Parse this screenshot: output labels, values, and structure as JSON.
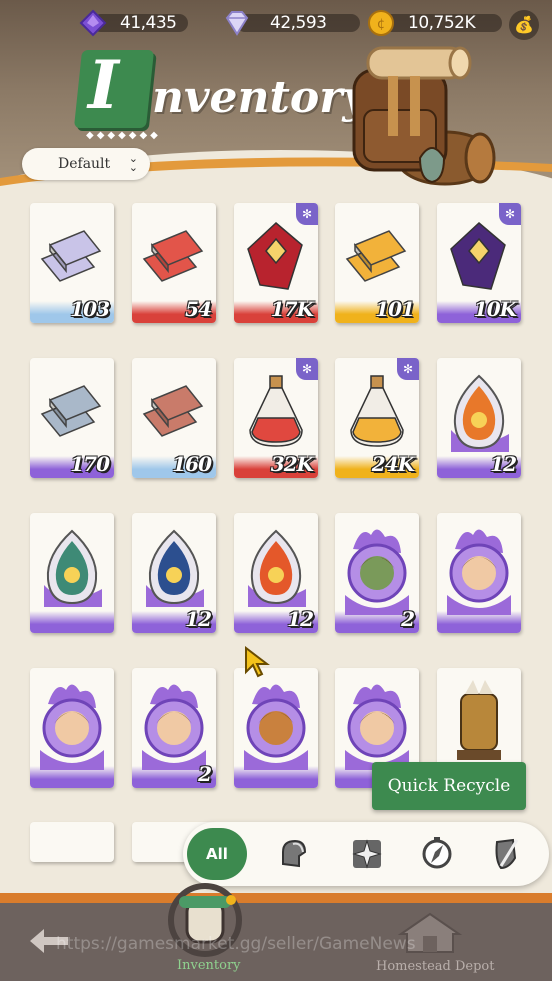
{
  "resources": [
    {
      "name": "amethyst-icon",
      "value": "41,435",
      "color": "#7b4fd4"
    },
    {
      "name": "diamond-icon",
      "value": "42,593",
      "color": "#c9c2ee"
    },
    {
      "name": "gold-coin-icon",
      "value": "10,752K",
      "color": "#f0b21c"
    }
  ],
  "header": {
    "title_initial": "I",
    "title_rest": "nventory"
  },
  "sort": {
    "label": "Default"
  },
  "items": [
    {
      "icon": "silver-ingot-icon",
      "qty": "103",
      "rarity": "#9fc7ea",
      "badge": false
    },
    {
      "icon": "red-ingot-icon",
      "qty": "54",
      "rarity": "#d9413a",
      "badge": false
    },
    {
      "icon": "ruby-gem-icon",
      "qty": "17K",
      "rarity": "#d9413a",
      "badge": true
    },
    {
      "icon": "gold-ingot-icon",
      "qty": "101",
      "rarity": "#f0b21c",
      "badge": false
    },
    {
      "icon": "purple-gem-icon",
      "qty": "10K",
      "rarity": "#8e62d9",
      "badge": true
    },
    {
      "icon": "steel-ingot-icon",
      "qty": "170",
      "rarity": "#8e62d9",
      "badge": false
    },
    {
      "icon": "copper-ingot-icon",
      "qty": "160",
      "rarity": "#9fc7ea",
      "badge": false
    },
    {
      "icon": "red-potion-icon",
      "qty": "32K",
      "rarity": "#d9413a",
      "badge": true
    },
    {
      "icon": "gold-potion-icon",
      "qty": "24K",
      "rarity": "#f0b21c",
      "badge": true
    },
    {
      "icon": "fire-egg-icon",
      "qty": "12",
      "rarity": "#8e62d9",
      "badge": false
    },
    {
      "icon": "wind-egg-icon",
      "qty": "",
      "rarity": "#8e62d9",
      "badge": false
    },
    {
      "icon": "water-egg-icon",
      "qty": "12",
      "rarity": "#8e62d9",
      "badge": false
    },
    {
      "icon": "flame-egg-icon",
      "qty": "12",
      "rarity": "#8e62d9",
      "badge": false
    },
    {
      "icon": "goblin-portrait-icon",
      "qty": "2",
      "rarity": "#8e62d9",
      "badge": false
    },
    {
      "icon": "girl-portrait-icon",
      "qty": "",
      "rarity": "#8e62d9",
      "badge": false
    },
    {
      "icon": "knight-portrait-icon",
      "qty": "",
      "rarity": "#8e62d9",
      "badge": false
    },
    {
      "icon": "redhead-portrait-icon",
      "qty": "2",
      "rarity": "#8e62d9",
      "badge": false
    },
    {
      "icon": "beast-portrait-icon",
      "qty": "",
      "rarity": "#8e62d9",
      "badge": false
    },
    {
      "icon": "swordsman-portrait-icon",
      "qty": "",
      "rarity": "#8e62d9",
      "badge": false
    },
    {
      "icon": "armor-figure-icon",
      "qty": "",
      "rarity": "#8e62d9",
      "badge": false
    }
  ],
  "recycle": {
    "label": "Quick Recycle"
  },
  "filters": {
    "all_label": "All",
    "icons": [
      "helmet-icon",
      "shuriken-icon",
      "compass-icon",
      "shield-sword-icon"
    ]
  },
  "nav": {
    "inventory_label": "Inventory",
    "depot_label": "Homestead Depot"
  },
  "watermark": "https://gamesmarket.gg/seller/GameNews",
  "colors": {
    "accent": "#3d8a4f",
    "bottom_bar": "#6d625e",
    "stripe": "#d97c2c"
  }
}
